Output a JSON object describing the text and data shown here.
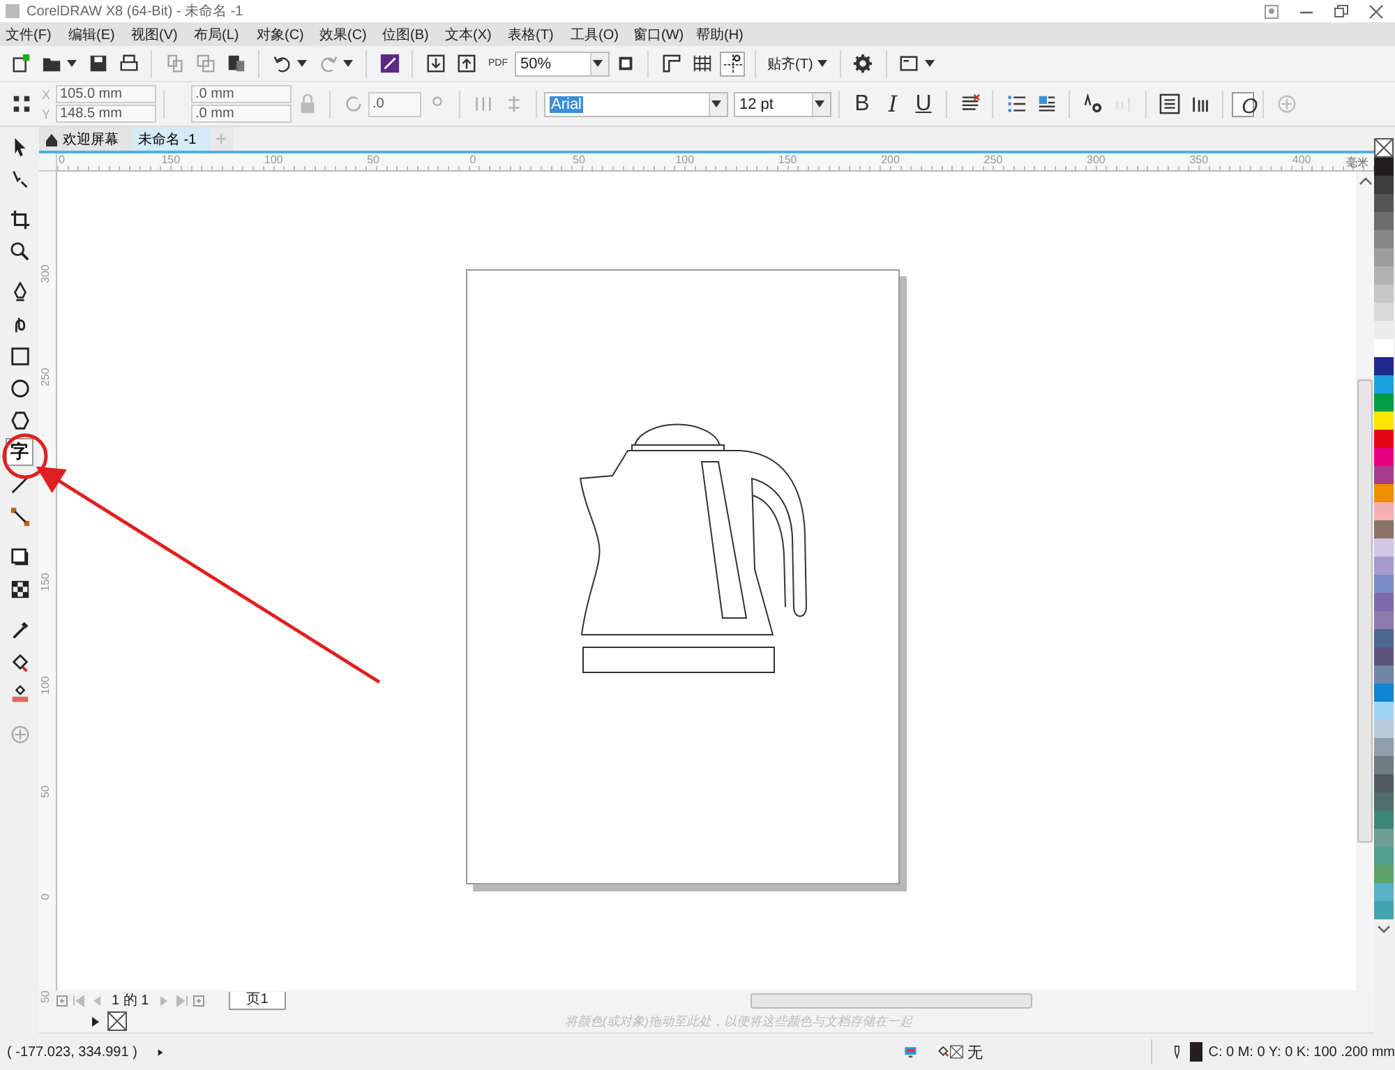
{
  "title_bar": {
    "title": "CorelDRAW X8 (64-Bit) - 未命名 -1"
  },
  "menu": [
    {
      "label": "文件(F)"
    },
    {
      "label": "编辑(E)"
    },
    {
      "label": "视图(V)"
    },
    {
      "label": "布局(L)"
    },
    {
      "label": "对象(C)"
    },
    {
      "label": "效果(C)"
    },
    {
      "label": "位图(B)"
    },
    {
      "label": "文本(X)"
    },
    {
      "label": "表格(T)"
    },
    {
      "label": "工具(O)"
    },
    {
      "label": "窗口(W)"
    },
    {
      "label": "帮助(H)"
    }
  ],
  "toolbar": {
    "pdf_label": "PDF",
    "zoom": "50%",
    "snap": "贴齐(T)"
  },
  "property_bar": {
    "x_label": "X",
    "x": "105.0 mm",
    "y_label": "Y",
    "y": "148.5 mm",
    "width": ".0 mm",
    "height": ".0 mm",
    "angle": ".0",
    "font": "Arial",
    "font_size": "12 pt",
    "bold": "B",
    "italic": "I",
    "underline": "U",
    "object_style": "O"
  },
  "doc_tabs": [
    {
      "label": "欢迎屏幕",
      "kind": "home",
      "selected": false
    },
    {
      "label": "未命名 -1",
      "kind": "doc",
      "selected": true
    }
  ],
  "rulers": {
    "top": [
      {
        "label": "0"
      },
      {
        "label": "150"
      },
      {
        "label": "100"
      },
      {
        "label": "50"
      },
      {
        "label": "0"
      },
      {
        "label": "50"
      },
      {
        "label": "100"
      },
      {
        "label": "150"
      },
      {
        "label": "200"
      },
      {
        "label": "250"
      },
      {
        "label": "300"
      },
      {
        "label": "350"
      },
      {
        "label": "400"
      }
    ],
    "unit": "毫米",
    "left": [
      {
        "label": "300"
      },
      {
        "label": "250"
      },
      {
        "label": "150"
      },
      {
        "label": "100"
      },
      {
        "label": "50"
      },
      {
        "label": "0"
      },
      {
        "label": "50"
      }
    ]
  },
  "tools": [
    {
      "kind": "pick",
      "selected": false
    },
    {
      "kind": "shape",
      "selected": false
    },
    {
      "kind": "crop",
      "selected": false
    },
    {
      "kind": "zoom",
      "selected": false
    },
    {
      "kind": "pen",
      "selected": false
    },
    {
      "kind": "curve",
      "selected": false
    },
    {
      "kind": "rect",
      "selected": false
    },
    {
      "kind": "ellipse",
      "selected": false
    },
    {
      "kind": "polygon",
      "selected": false
    },
    {
      "kind": "text",
      "glyph": "字",
      "selected": true
    },
    {
      "kind": "line",
      "selected": false
    },
    {
      "kind": "connector",
      "selected": false
    },
    {
      "kind": "shadow",
      "selected": false
    },
    {
      "kind": "transparency",
      "selected": false
    },
    {
      "kind": "eyedropper",
      "selected": false
    },
    {
      "kind": "fill",
      "selected": false
    },
    {
      "kind": "smartfill",
      "selected": false
    },
    {
      "kind": "add",
      "selected": false
    }
  ],
  "page_nav": {
    "count": "1 的 1",
    "page_tab": "页1"
  },
  "palette": [
    {
      "color": "#231f20"
    },
    {
      "color": "#3d3d3d"
    },
    {
      "color": "#555555"
    },
    {
      "color": "#6d6d6d"
    },
    {
      "color": "#858585"
    },
    {
      "color": "#9d9d9d"
    },
    {
      "color": "#b1b1b1"
    },
    {
      "color": "#c6c6c6"
    },
    {
      "color": "#d9d9d9"
    },
    {
      "color": "#ececec"
    },
    {
      "color": "#ffffff"
    },
    {
      "color": "#1f2a8c"
    },
    {
      "color": "#1ba1e2"
    },
    {
      "color": "#009b48"
    },
    {
      "color": "#ffe600"
    },
    {
      "color": "#e30613"
    },
    {
      "color": "#e5007e"
    },
    {
      "color": "#a63c8c"
    },
    {
      "color": "#f28c00"
    },
    {
      "color": "#f4b0b5"
    },
    {
      "color": "#8c7265"
    },
    {
      "color": "#d1c8e6"
    },
    {
      "color": "#a79bcb"
    },
    {
      "color": "#7b8cc8"
    },
    {
      "color": "#7c6aad"
    },
    {
      "color": "#8d7aac"
    },
    {
      "color": "#4a6792"
    },
    {
      "color": "#5c5479"
    },
    {
      "color": "#6f86a5"
    },
    {
      "color": "#0e86d4"
    },
    {
      "color": "#9fd3f2"
    },
    {
      "color": "#b8cbd8"
    },
    {
      "color": "#8f9ea8"
    },
    {
      "color": "#6f7b82"
    },
    {
      "color": "#4e5a5f"
    },
    {
      "color": "#4f6e69"
    },
    {
      "color": "#3c8775"
    },
    {
      "color": "#6f9d91"
    },
    {
      "color": "#4f9f8f"
    },
    {
      "color": "#5fa36b"
    },
    {
      "color": "#58b3c8"
    },
    {
      "color": "#44a3b0"
    }
  ],
  "palette_hint": "将颜色(或对象)拖动至此处，以便将这些颜色与文档存储在一起",
  "status": {
    "coords": "( -177.023, 334.991 )",
    "fill": "无",
    "outline": "C: 0 M: 0 Y: 0 K: 100  .200 mm"
  }
}
